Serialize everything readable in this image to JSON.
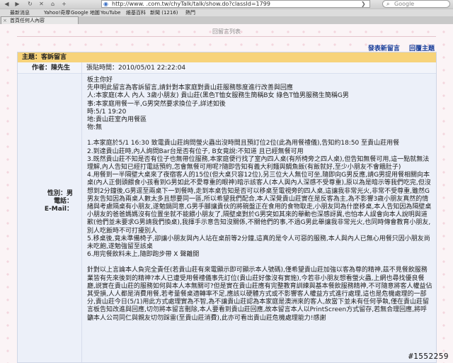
{
  "browser": {
    "url_display": "http://www.                      .com.tw/chyTalk/talk/show.do?classId=1799",
    "search_placeholder": "Google",
    "bookmarks": [
      "最新消息",
      "Yahoo!奇摩",
      "Google 地圖",
      "YouTube",
      "維基百科",
      "新聞 (1216)",
      "熱門"
    ],
    "active_tab": "首頁任何人內容",
    "go_label": "❯"
  },
  "page": {
    "section_title": "回留言列表",
    "actions": {
      "new_post": "發表新留言",
      "reply": "回覆主題"
    }
  },
  "post": {
    "subject_label": "主題：客訴留言",
    "author_label": "作者：陳先生",
    "posted_time": "張貼時間：2010/05/01 22:22:04",
    "sidebar": {
      "gender": "性別：男",
      "phone": "電話：",
      "email": "E-Mail："
    },
    "paragraphs": [
      "板主你好\n先申明此留言為客訴留言,請針對本家庭對貴山莊服務態度進行改善與回應\n人:本家庭(本人 內人 3歲小朋友) 貴山莊(黑色T恤女服務生簡稱B女 綠色T恤男服務生簡稱G男\n事:本家庭用餐一半,G男突然要求換位子,詳述如後\n時:5/1 19:20\n地:貴山莊室內用餐區\n物:無",
      "1.本家庭於5/1 16:30 致電貴山莊詢問螢火蟲出沒時間且預訂位2位(此為用餐禮儀),告知約18:50 至貴山莊用餐\n2.到達貴山莊時,內人詢問Bar台是否有位子, B女竟說:不知道 且已經無餐可用\n3.既然貴山莊不知是否有位子也無帶位服務,本家庭便行找了室內四人桌(有所椅旁之四人桌),但告知無餐可用,這一點就無法理解,內人告知已經打電話預約,怎會無餐可用呢?隨即告知有義大利麵與鯛魚飯(有飯就好,至少小朋友不會餓肚子)\n4.用餐到一半隔壁大桌來了夜宿客人的15位(但大桌只容12位),另三位大人無位可坐,隨即向G男反應,請G男提用餐相關向本桌(內人正側頭餵食小孩看到G男如此不愛尊重的眼神)暗示該客人(本人與內人深感不受尊重),原以為是暗示等我們吃完,但沒想到2分鐘後,G男逕至兩桌下一到餐時,走到本桌告知是否可以移桌至電視旁的四人桌,這讓我非常光火,非常不受尊重,雖然G男友告知因為兩桌人數太多且想要同一區,所以希望我們配合,本人深覺貴山莊實在是反客為主,為不影響3歲小朋友真然的情緒與考慮隔桌有小朋友,遂勉鍋同意,G男手腳讓貴伙的將碗盤正在食用的食物取走,小朋友同為什麼移桌,本人告知因為隔壁桌小朋友的爸爸媽媽沒有位置坐就不能餵小朋友了,隔壁桌對於G男突如其來的舉動也深感訝異,也怕本人誤會向本人說明與道歉(他們並未要求G男請我們換桌),我揮手示意告知沒關係,不關他們的事,不過G男此舉讓我非常光火,也同時傳會教育小朋友,別人吃飯時不可打擾別人\n5.移桌後,竟未準備椅子,卻讓小朋友與內人站在桌前等2分鐘,這真的是令人可惡的服務,本人與內人已無心用餐只因小朋友尚未吃飽,遂勉強留至該桌\n6.用完餐飲料未上,隨即跑步帶 X 聲離開",
      "針對以上言論本人負完全責任(若貴山莊有來電顯示即可顯示本人號碼),僅希望貴山莊加強以客為尊的精神,茲不見餐飲服務業皆有先來後到的精神?本人已遭受用餐禮儀事先訂位(貴山莊好像沒有實施),今若非小朋友想看螢火蟲,上網也尋找優良餐廳,説實在貴山莊的服務如何與本人本無關可?但是實在貴山莊應有完整教育訓練與基本餐飲服務精神,不可隨意將客人權益佔其受損,人人都是消費用餐,若考量餐桌適轉率不足,應該以硬體方式或不影響客人權益方式進行處理,這也是危機處理的一部分,貴山莊今日(5/1)用此方式處理實為不智,為不讓貴山莊認為本家庭是澳洲來的客人,故當下並未有任何爭執,僅在貴山莊留言板告知改進與回應,切勿將本留言刪除,本人要看到貴山莊回應,故本留言本人以PrintScreen方式留存,若無合理回應,將呼籲本人公司同仁與親友切勿踩雷(至貴山莊消費),此亦可看出貴山莊危機處理能力!感謝"
    ]
  },
  "watermark": "#1552259",
  "colors": {
    "subject_bar": "#f7d37a",
    "post_bg": "#ecf0f9",
    "link": "#1a3f9a"
  },
  "icons": {
    "back": "arrow-left",
    "forward": "arrow-right",
    "reload": "reload",
    "stop": "stop",
    "home": "home",
    "add": "plus",
    "search": "search"
  }
}
